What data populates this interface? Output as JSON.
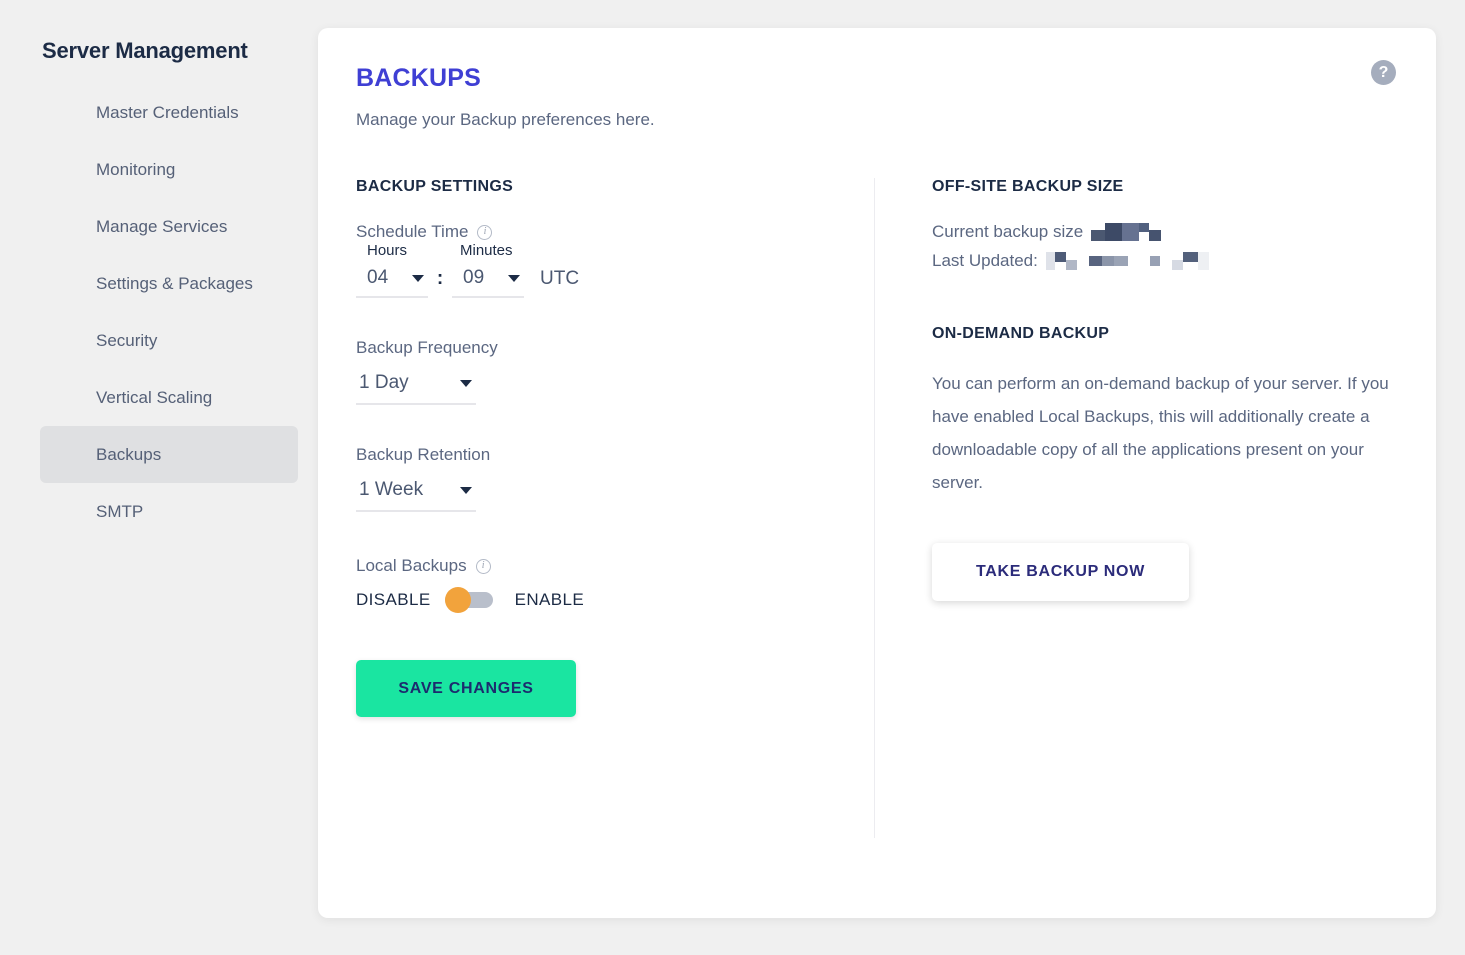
{
  "sidebar": {
    "title": "Server Management",
    "items": [
      {
        "label": "Master Credentials",
        "active": false
      },
      {
        "label": "Monitoring",
        "active": false
      },
      {
        "label": "Manage Services",
        "active": false
      },
      {
        "label": "Settings & Packages",
        "active": false
      },
      {
        "label": "Security",
        "active": false
      },
      {
        "label": "Vertical Scaling",
        "active": false
      },
      {
        "label": "Backups",
        "active": true
      },
      {
        "label": "SMTP",
        "active": false
      }
    ]
  },
  "header": {
    "title": "BACKUPS",
    "subtitle": "Manage your Backup preferences here.",
    "help_icon": "question-mark-icon",
    "help_icon_glyph": "?"
  },
  "backup_settings": {
    "section_title": "BACKUP SETTINGS",
    "schedule_time": {
      "label": "Schedule Time",
      "info_icon": "info-icon",
      "info_glyph": "i",
      "hours_label": "Hours",
      "minutes_label": "Minutes",
      "hours_value": "04",
      "minutes_value": "09",
      "separator": ":",
      "timezone": "UTC"
    },
    "frequency": {
      "label": "Backup Frequency",
      "value": "1 Day"
    },
    "retention": {
      "label": "Backup Retention",
      "value": "1 Week"
    },
    "local_backups": {
      "label": "Local Backups",
      "info_icon": "info-icon",
      "info_glyph": "i",
      "off_label": "DISABLE",
      "on_label": "ENABLE",
      "state": "disabled",
      "knob_color": "#f2a33c",
      "track_color": "#b9bfcb"
    },
    "save_label": "SAVE CHANGES"
  },
  "offsite": {
    "section_title": "OFF-SITE BACKUP SIZE",
    "current_size_label": "Current backup size",
    "current_size_value": "[redacted]",
    "last_updated_label": "Last Updated:",
    "last_updated_value": "[redacted]"
  },
  "ondemand": {
    "section_title": "ON-DEMAND BACKUP",
    "description": "You can perform an on-demand backup of your server. If you have enabled Local Backups, this will additionally create a downloadable copy of all the applications present on your server.",
    "button_label": "TAKE BACKUP NOW"
  },
  "colors": {
    "accent_title": "#3f3fd4",
    "save_button_bg": "#1ae5a1",
    "save_button_text": "#1c2b6e",
    "take_button_text": "#2b2b7a",
    "text_dark": "#1c2b45",
    "text_muted": "#5b6781",
    "page_bg": "#f0f0f0",
    "card_bg": "#ffffff",
    "sidebar_active_bg": "#dfe0e2"
  }
}
